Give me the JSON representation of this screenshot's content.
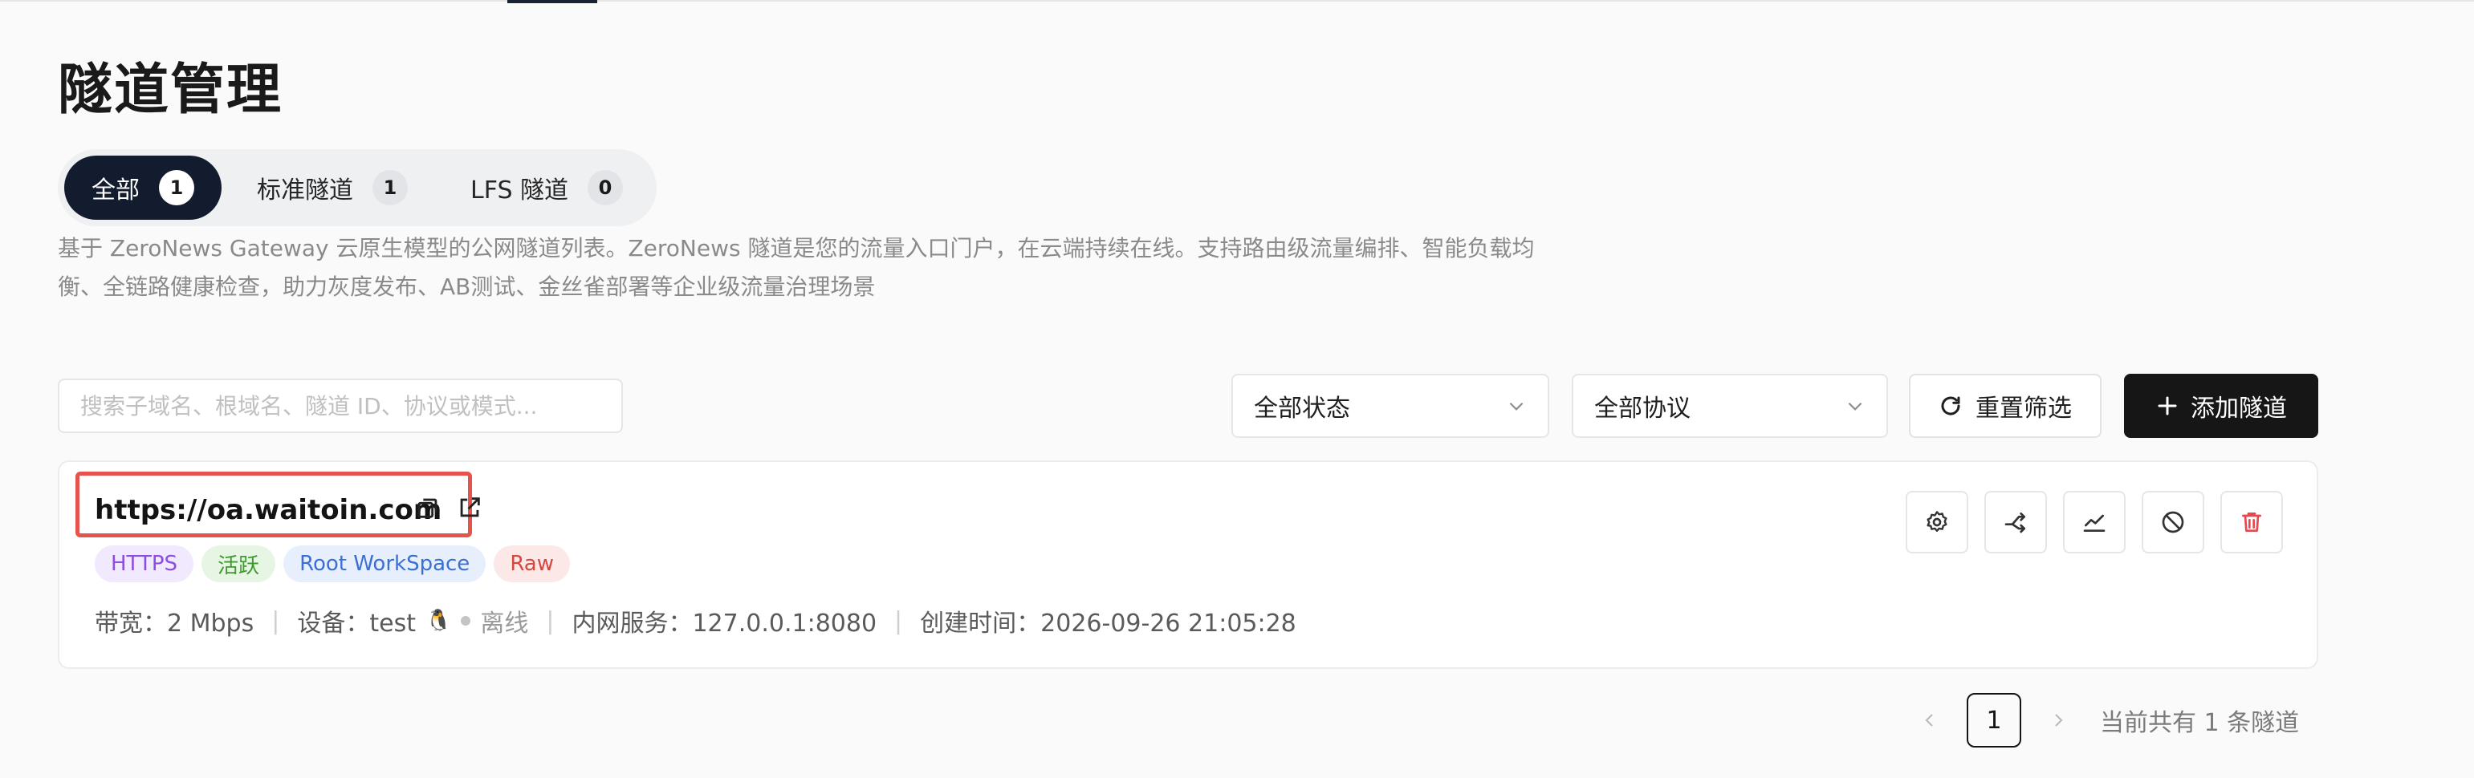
{
  "page": {
    "title": "隧道管理"
  },
  "tabs": [
    {
      "label": "全部",
      "count": "1",
      "active": true
    },
    {
      "label": "标准隧道",
      "count": "1",
      "active": false
    },
    {
      "label": "LFS 隧道",
      "count": "0",
      "active": false
    }
  ],
  "description": {
    "line1": "基于 ZeroNews Gateway 云原生模型的公网隧道列表。ZeroNews 隧道是您的流量入口门户，在云端持续在线。支持路由级流量编排、智能负载均",
    "line2": "衡、全链路健康检查，助力灰度发布、AB测试、金丝雀部署等企业级流量治理场景"
  },
  "filters": {
    "search_placeholder": "搜索子域名、根域名、隧道 ID、协议或模式...",
    "status_select": "全部状态",
    "protocol_select": "全部协议",
    "reset_label": "重置筛选",
    "add_label": "添加隧道"
  },
  "tunnel": {
    "url": "https://oa.waitoin.com",
    "tags": [
      "HTTPS",
      "活跃",
      "Root WorkSpace",
      "Raw"
    ],
    "bandwidth": "带宽：2 Mbps",
    "device": "设备：test",
    "device_os_icon": "linux-penguin",
    "device_status": "离线",
    "internal_service": "内网服务：127.0.0.1:8080",
    "created": "创建时间：2026-09-26 21:05:28"
  },
  "pagination": {
    "current": "1",
    "total_text": "当前共有 1 条隧道"
  },
  "colors": {
    "primary_dark": "#131c2e",
    "button_dark": "#161616",
    "highlight_red": "#e5534b",
    "delete_red": "#e5484d"
  }
}
